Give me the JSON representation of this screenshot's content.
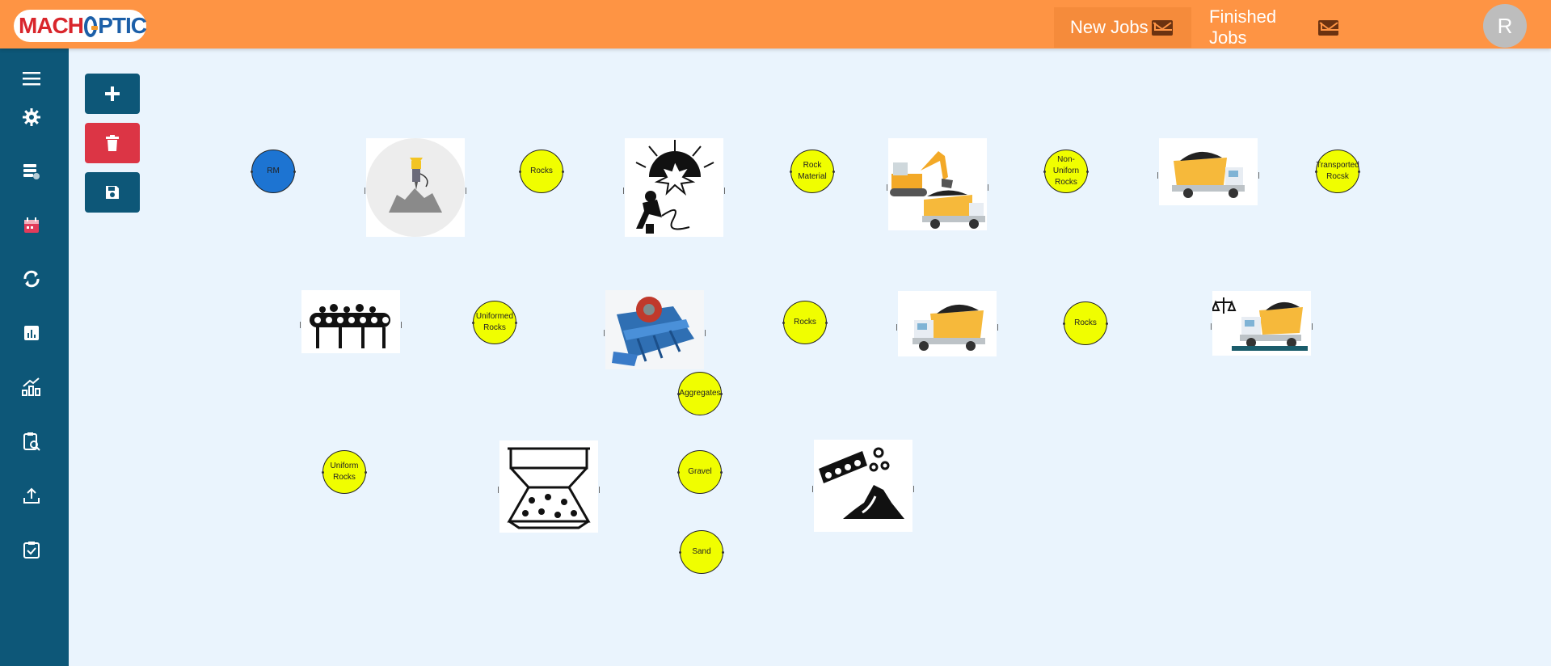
{
  "brand": {
    "part1": "MACH",
    "part2": "PTIC"
  },
  "header": {
    "tabs": [
      {
        "label": "New Jobs"
      },
      {
        "label": "Finished Jobs"
      }
    ],
    "avatar_initial": "R"
  },
  "sidebar": {
    "items": [
      "menu-icon",
      "settings-icon",
      "database-icon",
      "calendar-icon",
      "sync-icon",
      "report-icon",
      "chart-icon",
      "clipboard-search-icon",
      "upload-icon",
      "checklist-icon"
    ]
  },
  "toolbar": {
    "add": "plus-icon",
    "delete": "trash-icon",
    "save": "floppy-icon"
  },
  "nodes": {
    "rm": "RM",
    "rocks1": "Rocks",
    "rock_material": "Rock Material",
    "non_uniform": "Non-Uniforn Rocks",
    "transported": "Transported Rocsk",
    "uniformed": "Uniformed Rocks",
    "rocks2": "Rocks",
    "rocks3": "Rocks",
    "aggregates": "Aggregates",
    "uniform_rocks": "Uniform Rocks",
    "gravel": "Gravel",
    "sand": "Sand"
  },
  "colors": {
    "header": "#fe9444",
    "sidebar": "#0d5778",
    "canvas": "#eaf4fd",
    "node_yellow": "#f0fe00",
    "node_blue": "#1d74d2",
    "delete": "#dc3545"
  }
}
